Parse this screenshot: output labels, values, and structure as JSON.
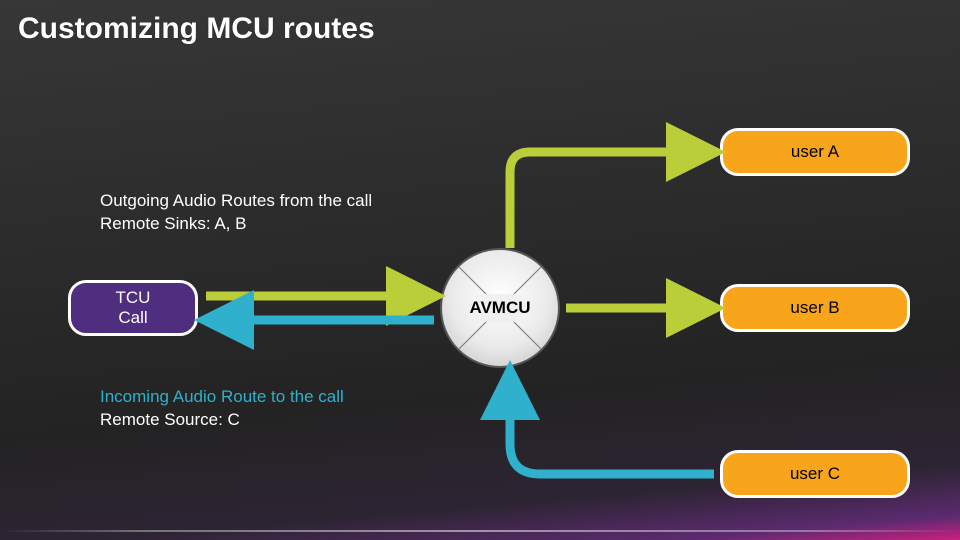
{
  "title": "Customizing MCU routes",
  "nodes": {
    "tcu": "TCU\nCall",
    "avmcu": "AVMCU",
    "userA": "user A",
    "userB": "user B",
    "userC": "user C"
  },
  "captions": {
    "outgoing_line1": "Outgoing Audio Routes from the call",
    "outgoing_line2": "Remote Sinks: A, B",
    "incoming_line1": "Incoming Audio Route to the call",
    "incoming_line2": "Remote Source: C"
  },
  "colors": {
    "green": "#bace3a",
    "teal": "#2fb0cc"
  }
}
